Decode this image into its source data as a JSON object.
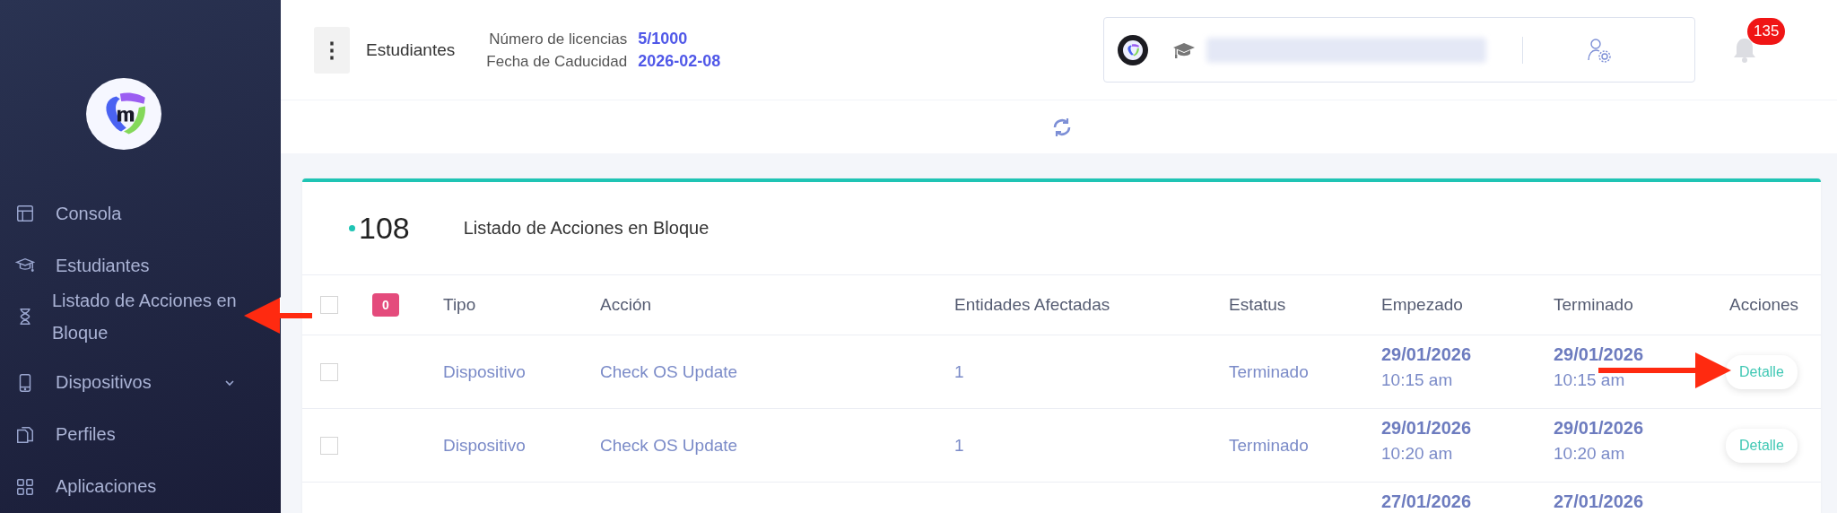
{
  "sidebar": {
    "items": [
      {
        "label": "Consola",
        "selected": false,
        "expandable": false
      },
      {
        "label": "Estudiantes",
        "selected": false,
        "expandable": false
      },
      {
        "label": "Listado de Acciones en Bloque",
        "selected": true,
        "expandable": false
      },
      {
        "label": "Dispositivos",
        "selected": false,
        "expandable": true
      },
      {
        "label": "Perfiles",
        "selected": false,
        "expandable": false
      },
      {
        "label": "Aplicaciones",
        "selected": false,
        "expandable": false
      }
    ]
  },
  "header": {
    "menu_button": "⋮",
    "section": "Estudiantes",
    "info": [
      {
        "label": "Número de licencias",
        "value": "5/1000"
      },
      {
        "label": "Fecha de Caducidad",
        "value": "2026-02-08"
      }
    ],
    "notifications": {
      "count": "135"
    }
  },
  "card": {
    "count": "108",
    "title": "Listado de Acciones en Bloque",
    "table": {
      "select_all": {
        "checked": false
      },
      "selected_count": "0",
      "columns": [
        "Tipo",
        "Acción",
        "Entidades Afectadas",
        "Estatus",
        "Empezado",
        "Terminado",
        "Acciones"
      ],
      "rows": [
        {
          "checked": false,
          "tipo": "Dispositivo",
          "accion": "Check OS Update",
          "entidades": "1",
          "estatus": "Terminado",
          "empezado": {
            "date": "29/01/2026",
            "time": "10:15 am"
          },
          "terminado": {
            "date": "29/01/2026",
            "time": "10:15 am"
          },
          "action": "Detalle"
        },
        {
          "checked": false,
          "tipo": "Dispositivo",
          "accion": "Check OS Update",
          "entidades": "1",
          "estatus": "Terminado",
          "empezado": {
            "date": "29/01/2026",
            "time": "10:20 am"
          },
          "terminado": {
            "date": "29/01/2026",
            "time": "10:20 am"
          },
          "action": "Detalle"
        },
        {
          "empezado": {
            "date": "27/01/2026"
          },
          "terminado": {
            "date": "27/01/2026"
          }
        }
      ]
    }
  },
  "annotations": [
    {
      "kind": "arrow",
      "pointing_left": true
    },
    {
      "kind": "arrow",
      "pointing_left": false
    }
  ]
}
